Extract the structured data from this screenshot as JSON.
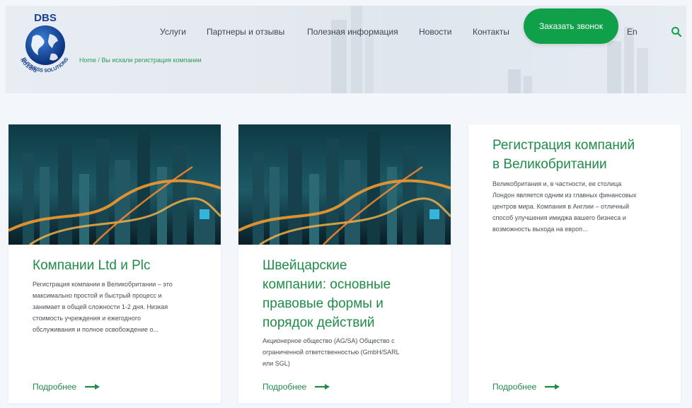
{
  "header": {
    "logo": {
      "brand": "DBS",
      "ring_top": "DIPTON",
      "ring_bottom": "BUSINESS SOLUTIONS"
    },
    "nav": [
      {
        "label": "Услуги"
      },
      {
        "label": "Партнеры и отзывы"
      },
      {
        "label": "Полезная информация"
      },
      {
        "label": "Новости"
      },
      {
        "label": "Контакты"
      }
    ],
    "cta_label": "Заказать звонок",
    "lang_label": "En",
    "breadcrumb": {
      "home": "Home",
      "separator": " / ",
      "current": "Вы искали регистрация компании"
    }
  },
  "colors": {
    "accent": "#11a04a",
    "title_green": "#1f8c4a",
    "background": "#f3f7fb"
  },
  "cards": [
    {
      "title_lines": [
        "Компании Ltd и Plc"
      ],
      "text_lines": [
        "Регистрация компании в Великобритании – это",
        "максимально простой и быстрый процесс и",
        "занимает в общей сложности 1-2 дня. Низкая",
        "стоимость учреждения и ежегодного",
        "обслуживания и полное освобождение о..."
      ],
      "more_label": "Подробнее"
    },
    {
      "title_lines": [
        "Швейцарские",
        "компании: основные",
        "правовые формы и",
        "порядок действий"
      ],
      "text_lines": [
        "Акционерное общество (AG/SA) Общество с",
        "ограниченной ответственностью (GmbH/SARL",
        "или SGL)"
      ],
      "more_label": "Подробнее"
    },
    {
      "title_lines": [
        "Регистрация компаний",
        "в Великобритании"
      ],
      "text_lines": [
        "Великобритания и, в частности, ее столица",
        "Лондон является одним из главных финансовых",
        "центров мира. Компания в Англии – отличный",
        "способ улучшения имиджа вашего бизнеса и",
        "возможность выхода на европ..."
      ],
      "more_label": "Подробнее"
    }
  ]
}
